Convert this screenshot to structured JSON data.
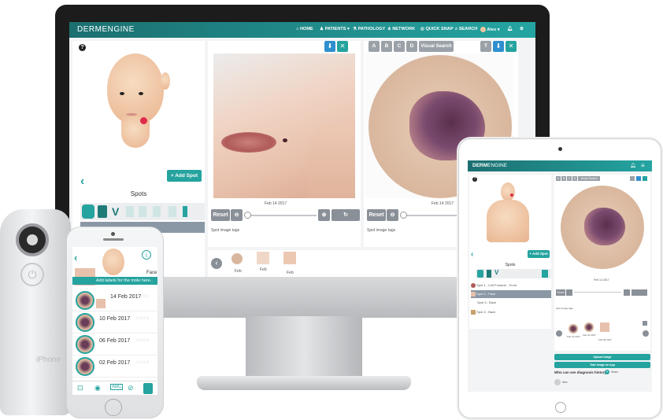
{
  "desktop": {
    "brand": {
      "bold": "DERM",
      "light": "ENGINE",
      "mark": "™"
    },
    "nav": [
      {
        "label": "HOME",
        "icon": "home-icon"
      },
      {
        "label": "PATIENTS ▾",
        "icon": "user-icon"
      },
      {
        "label": "PATHOLOGY",
        "icon": "flask-icon"
      },
      {
        "label": "NETWORK",
        "icon": "network-icon"
      },
      {
        "label": "QUICK SNAP",
        "icon": "camera-icon"
      },
      {
        "label": "SEARCH",
        "icon": "search-icon"
      },
      {
        "label": "Alex ▾",
        "icon": "avatar"
      }
    ],
    "help_icon": "?",
    "add_spot": "+ Add Spot",
    "spots_title": "Spots",
    "image1": {
      "date": "Feb 14 2017",
      "reset": "Reset",
      "tags_label": "Spot image tags"
    },
    "image2": {
      "date": "Feb 14 2017",
      "reset": "Reset",
      "tags_label": "Spot image tags"
    },
    "compare_letters": [
      "A",
      "B",
      "C",
      "D"
    ],
    "visual_search": "Visual Search",
    "thumbnails": [
      {
        "label": "Feb"
      },
      {
        "label": "Feb"
      },
      {
        "label": "Feb"
      }
    ]
  },
  "phone": {
    "label": "Face",
    "hint": "Add labels for the mole here..",
    "entries": [
      {
        "date": "14 Feb 2017",
        "stars": "☆☆☆☆"
      },
      {
        "date": "10 Feb 2017",
        "stars": "☆☆☆☆"
      },
      {
        "date": "06 Feb 2017",
        "stars": "☆☆☆☆"
      },
      {
        "date": "02 Feb 2017",
        "stars": "☆☆☆☆"
      }
    ],
    "device_brand": "iPhone"
  },
  "tablet": {
    "brand": {
      "bold": "DERM",
      "light": "ENGINE",
      "mark": "™"
    },
    "compare_letters": [
      "A",
      "B",
      "C",
      "D"
    ],
    "visual_search": "Visual Search",
    "add_spot": "+ Add Spot",
    "spots_title": "Spots",
    "spot_list": [
      {
        "label": "Spot 1 - Left Forearm - Front",
        "selected": false
      },
      {
        "label": "Spot 2 - Face",
        "selected": true
      },
      {
        "label": "Spot 3 - Back",
        "selected": false
      },
      {
        "label": "Spot 4 - Back",
        "selected": false
      }
    ],
    "image_date": "Feb 14 2017",
    "reset": "Reset",
    "tags_label": "Spot image tags",
    "thumbs": [
      {
        "label": "Feb 14 2017"
      },
      {
        "label": "Feb 10 2017"
      },
      {
        "label": "Feb 06 2017"
      }
    ],
    "upload_image": "Upload Image",
    "take_image": "Take Image on App",
    "diagnosis_question": "Who can see diagnosis history",
    "share_label": "Share",
    "user_name": "Alex"
  }
}
